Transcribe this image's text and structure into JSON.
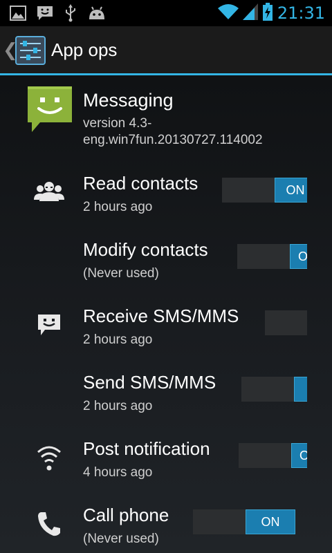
{
  "status_bar": {
    "time": "21:31",
    "notification_icons": [
      "gallery-icon",
      "sms-icon",
      "usb-icon",
      "android-debug-icon"
    ],
    "system_icons": [
      "wifi-icon",
      "signal-icon",
      "battery-charging-icon"
    ],
    "accent_color": "#33b5e5"
  },
  "action_bar": {
    "up_glyph": "❮",
    "title": "App ops",
    "icon": "settings-sliders-icon",
    "accent_color": "#33b5e5"
  },
  "app": {
    "name": "Messaging",
    "version": "version 4.3-eng.win7fun.20130727.114002",
    "icon": "messaging-app-icon",
    "icon_color": "#8cb23a"
  },
  "ops": [
    {
      "label": "Read contacts",
      "sub": "2 hours ago",
      "icon": "contacts-icon",
      "switch_state": "ON",
      "switch_text": "ON"
    },
    {
      "label": "Modify contacts",
      "sub": "(Never used)",
      "icon": "",
      "switch_state": "ON",
      "switch_text": "O"
    },
    {
      "label": "Receive SMS/MMS",
      "sub": "2 hours ago",
      "icon": "sms-icon",
      "switch_state": "OFF",
      "switch_text": ""
    },
    {
      "label": "Send SMS/MMS",
      "sub": "2 hours ago",
      "icon": "",
      "switch_state": "ON",
      "switch_text": ""
    },
    {
      "label": "Post notification",
      "sub": "4 hours ago",
      "icon": "notification-icon",
      "switch_state": "ON",
      "switch_text": "O"
    },
    {
      "label": "Call phone",
      "sub": "(Never used)",
      "icon": "phone-icon",
      "switch_state": "ON",
      "switch_text": "ON"
    }
  ]
}
